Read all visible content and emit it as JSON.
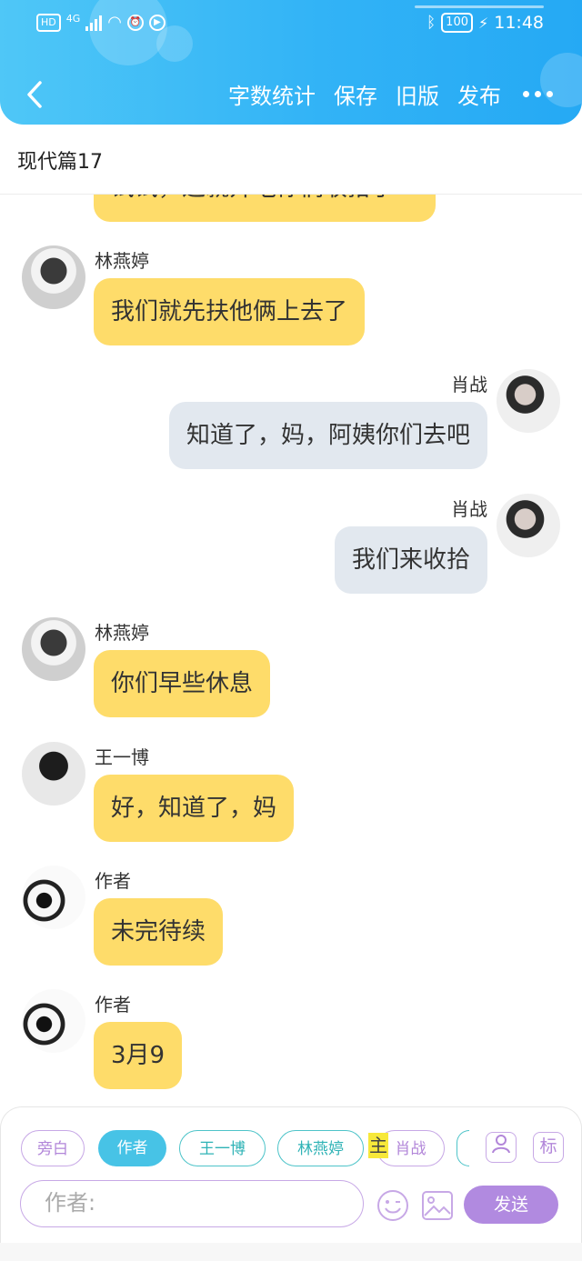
{
  "status_bar": {
    "left": {
      "hd": "HD",
      "network": "4G"
    },
    "right": {
      "battery": "100",
      "time": "11:48"
    }
  },
  "header": {
    "actions": [
      "字数统计",
      "保存",
      "旧版",
      "发布"
    ]
  },
  "doc_title": "现代篇17",
  "partial_message": "试试，这就开吃你们收拾了",
  "messages": [
    {
      "speaker": "林燕婷",
      "text": "我们就先扶他俩上去了",
      "side": "left"
    },
    {
      "speaker": "肖战",
      "text": "知道了，妈，阿姨你们去吧",
      "side": "right"
    },
    {
      "speaker": "肖战",
      "text": "我们来收拾",
      "side": "right"
    },
    {
      "speaker": "林燕婷",
      "text": "你们早些休息",
      "side": "left"
    },
    {
      "speaker": "王一博",
      "text": "好，知道了，妈",
      "side": "left"
    },
    {
      "speaker": "作者",
      "text": "未完待续",
      "side": "left"
    },
    {
      "speaker": "作者",
      "text": "3月9",
      "side": "left"
    }
  ],
  "roles": [
    "旁白",
    "作者",
    "王一博",
    "林燕婷",
    "肖战"
  ],
  "active_role": "作者",
  "highlight_mark": "主",
  "icons": {
    "portrait": "portrait-icon",
    "tag": "标"
  },
  "input": {
    "value": "作者:"
  },
  "send_label": "发送",
  "colors": {
    "header": "#32b3f6",
    "left_bubble": "#fedc6a",
    "right_bubble": "#e2e8ef",
    "accent_purple": "#b18ae0",
    "accent_teal": "#2fb3b6"
  }
}
